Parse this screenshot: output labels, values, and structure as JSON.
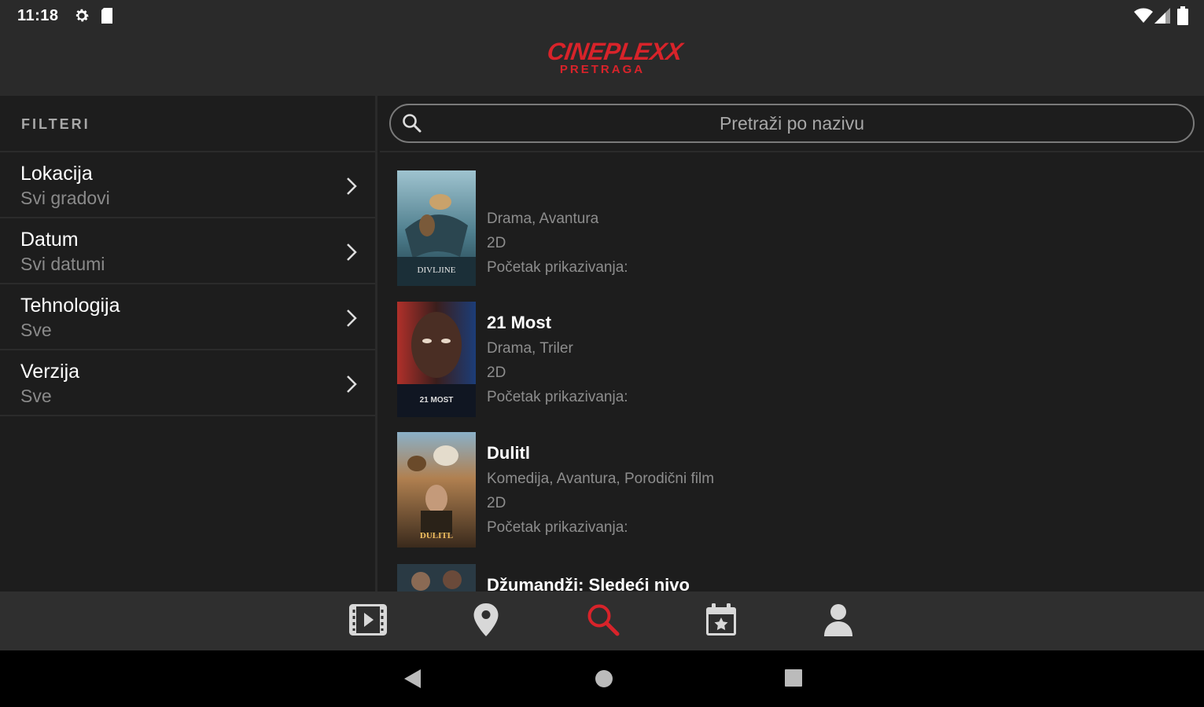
{
  "status_bar": {
    "time": "11:18"
  },
  "app": {
    "brand": "CINEPLEXX",
    "screen_title": "PRETRAGA",
    "accent": "#d8232a"
  },
  "filters": {
    "header": "FILTERI",
    "items": [
      {
        "title": "Lokacija",
        "value": "Svi gradovi"
      },
      {
        "title": "Datum",
        "value": "Svi datumi"
      },
      {
        "title": "Tehnologija",
        "value": "Sve"
      },
      {
        "title": "Verzija",
        "value": "Sve"
      }
    ]
  },
  "search": {
    "placeholder": "Pretraži po nazivu",
    "value": ""
  },
  "movies": [
    {
      "title": "",
      "genres": "Drama, Avantura",
      "format": "2D",
      "start_label": "Početak prikazivanja:",
      "poster_caption": "DIVLJINE"
    },
    {
      "title": "21 Most",
      "genres": "Drama, Triler",
      "format": "2D",
      "start_label": "Početak prikazivanja:",
      "poster_caption": "21 MOST"
    },
    {
      "title": "Dulitl",
      "genres": "Komedija, Avantura, Porodični film",
      "format": "2D",
      "start_label": "Početak prikazivanja:",
      "poster_caption": "DULITL"
    },
    {
      "title": "Džumandži: Sledeći nivo",
      "genres": "",
      "format": "",
      "start_label": "",
      "poster_caption": ""
    }
  ],
  "bottom_nav": [
    {
      "icon": "film-icon",
      "active": false
    },
    {
      "icon": "location-pin-icon",
      "active": false
    },
    {
      "icon": "search-icon",
      "active": true
    },
    {
      "icon": "calendar-star-icon",
      "active": false
    },
    {
      "icon": "user-icon",
      "active": false
    }
  ]
}
